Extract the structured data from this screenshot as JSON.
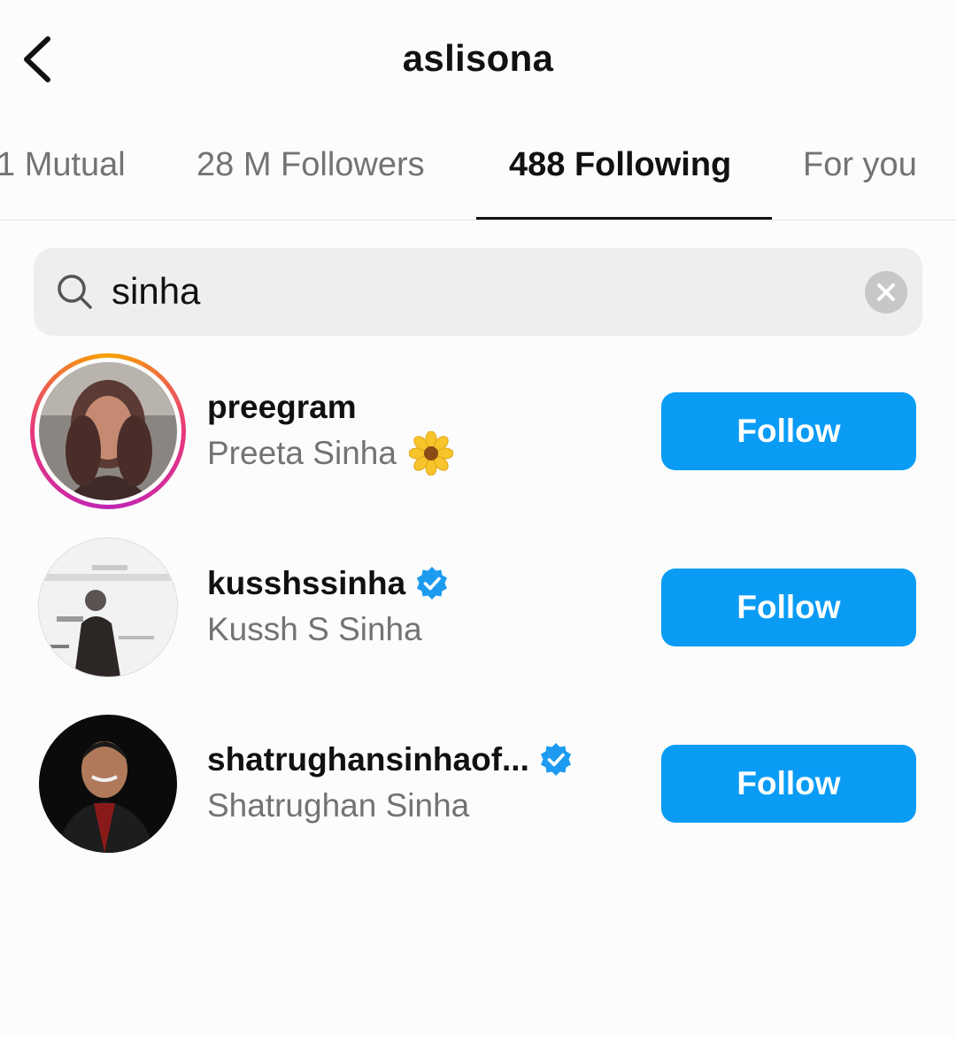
{
  "header": {
    "title": "aslisona",
    "back_icon": "chevron-left-icon"
  },
  "tabs": [
    {
      "label": "1 Mutual",
      "active": false
    },
    {
      "label": "28 M Followers",
      "active": false
    },
    {
      "label": "488 Following",
      "active": true
    },
    {
      "label": "For you",
      "active": false
    }
  ],
  "search": {
    "value": "sinha",
    "icon": "search-icon",
    "clear_icon": "clear-icon"
  },
  "results": [
    {
      "username": "preegram",
      "full_name": "Preeta Sinha",
      "verified": false,
      "emoji": "sunflower",
      "story_ring": true,
      "follow_label": "Follow"
    },
    {
      "username": "kusshssinha",
      "full_name": "Kussh S Sinha",
      "verified": true,
      "story_ring": false,
      "follow_label": "Follow"
    },
    {
      "username": "shatrughansinhaof...",
      "full_name": "Shatrughan Sinha",
      "verified": true,
      "story_ring": false,
      "follow_label": "Follow"
    }
  ],
  "colors": {
    "follow_button": "#0a9cf5",
    "verified_badge": "#1d9bf0",
    "secondary_text": "#737373",
    "search_bg": "#eeeeee"
  }
}
